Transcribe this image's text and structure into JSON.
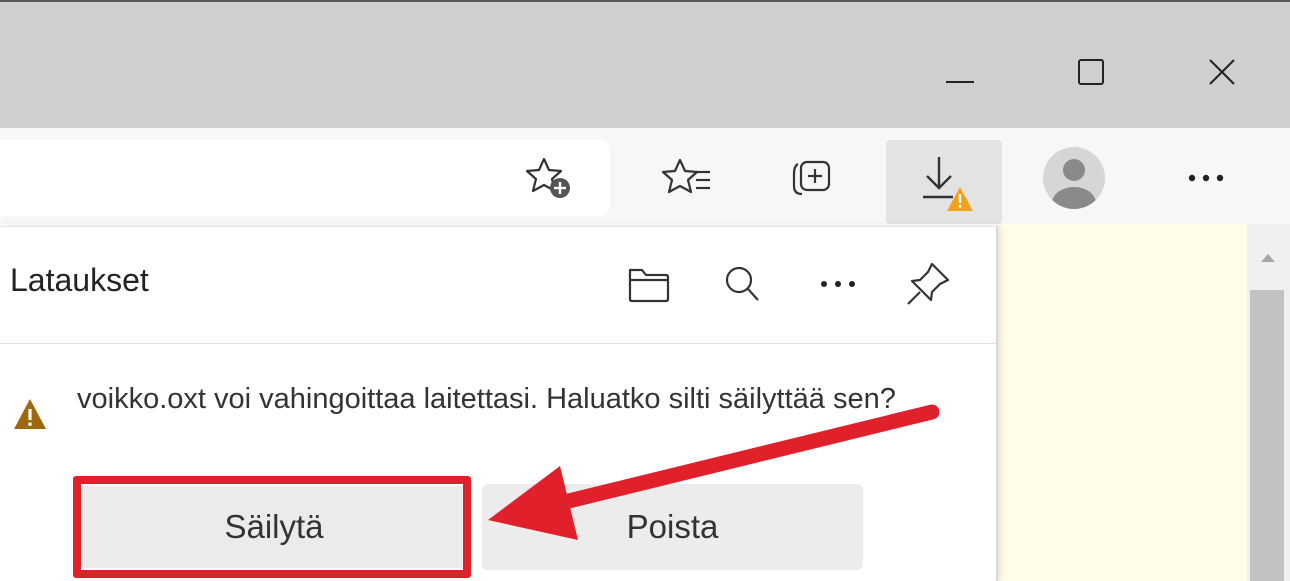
{
  "window_controls": {
    "minimize_icon": "minimize-icon",
    "maximize_icon": "maximize-icon",
    "close_icon": "close-icon"
  },
  "toolbar": {
    "address_bar_icon": "add-favorite-star-plus-icon",
    "favorites_icon": "favorites-list-icon",
    "collections_icon": "collections-icon",
    "downloads_icon": "download-warning-icon",
    "profile_icon": "profile-avatar-icon",
    "more_icon": "more-dots-icon"
  },
  "downloads_panel": {
    "title": "Lataukset",
    "header_icons": [
      "folder-icon",
      "search-icon",
      "more-dots-icon",
      "pin-icon"
    ],
    "warning_message": "voikko.oxt voi vahingoittaa laitettasi. Haluatko silti säilyttää sen?",
    "keep_label": "Säilytä",
    "delete_label": "Poista"
  },
  "colors": {
    "highlight": "#e0202b",
    "warning": "#f0a21a",
    "warning_dark": "#a0680e",
    "page_background": "#fffde9"
  }
}
